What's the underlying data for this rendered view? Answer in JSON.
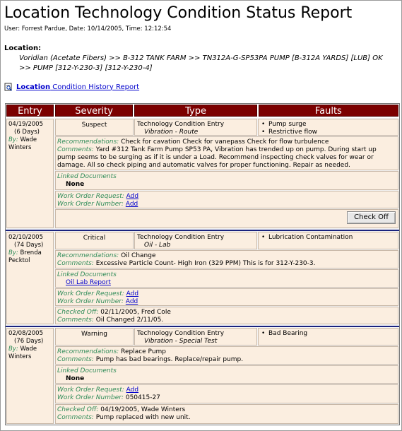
{
  "title": "Location Technology Condition Status Report",
  "user_line": "User: Forrest Pardue, Date: 10/14/2005, Time: 12:12:54",
  "location_label": "Location:",
  "location_path": "Voridian (Acetate Fibers) >> B-312 TANK FARM >> TN312A-G-SP53PA PUMP [B-312A YARDS] [LUB] OK >> PUMP [312-Y-230-3] [312-Y-230-4]",
  "history_link": {
    "bold": "Location",
    "rest": " Condition History Report"
  },
  "headers": {
    "entry": "Entry",
    "severity": "Severity",
    "type": "Type",
    "faults": "Faults"
  },
  "labels": {
    "by": "By:",
    "recommendations": "Recommendations:",
    "comments": "Comments:",
    "linked_documents": "Linked Documents",
    "work_order_request": "Work Order Request:",
    "work_order_number": "Work Order Number:",
    "checked_off": "Checked Off:"
  },
  "records": [
    {
      "date": "04/19/2005",
      "days": "(6 Days)",
      "by": "Wade Winters",
      "severity": "Suspect",
      "type": "Technology Condition Entry",
      "subtype": "Vibration - Route",
      "faults": [
        "Pump surge",
        "Restrictive flow"
      ],
      "recommendations": "Check for cavation Check for vanepass Check for flow turbulence",
      "comments": "Yard #312 Tank Farm Pump SP53 PA, Vibration has trended up on pump. During start up pump seems to be surging as if it is under a Load. Recommend inspecting check valves for wear or damage. All so check piping and automatic valves for proper functioning. Repair as needed.",
      "linked_doc": "None",
      "wo_request": "Add",
      "wo_number": "Add",
      "button": "Check Off"
    },
    {
      "date": "02/10/2005",
      "days": "(74 Days)",
      "by": "Brenda Pecktol",
      "severity": "Critical",
      "type": "Technology Condition Entry",
      "subtype": "Oil - Lab",
      "faults": [
        "Lubrication Contamination"
      ],
      "recommendations": "Oil Change",
      "comments": "Excessive Particle Count- High Iron (329 PPM) This is for 312-Y-230-3.",
      "linked_doc": "Oil Lab Report",
      "wo_request": "Add",
      "wo_number": "Add",
      "checked_off": "02/11/2005, Fred Cole",
      "checked_comments": "Oil Changed 2/11/05."
    },
    {
      "date": "02/08/2005",
      "days": "(76 Days)",
      "by": "Wade Winters",
      "severity": "Warning",
      "type": "Technology Condition Entry",
      "subtype": "Vibration - Special Test",
      "faults": [
        "Bad Bearing"
      ],
      "recommendations": "Replace Pump",
      "comments": "Pump has bad bearings. Replace/repair pump.",
      "linked_doc": "None",
      "wo_request": "Add",
      "wo_number": "050415-27",
      "checked_off": "04/19/2005, Wade Winters",
      "checked_comments": "Pump replaced with new unit."
    }
  ]
}
